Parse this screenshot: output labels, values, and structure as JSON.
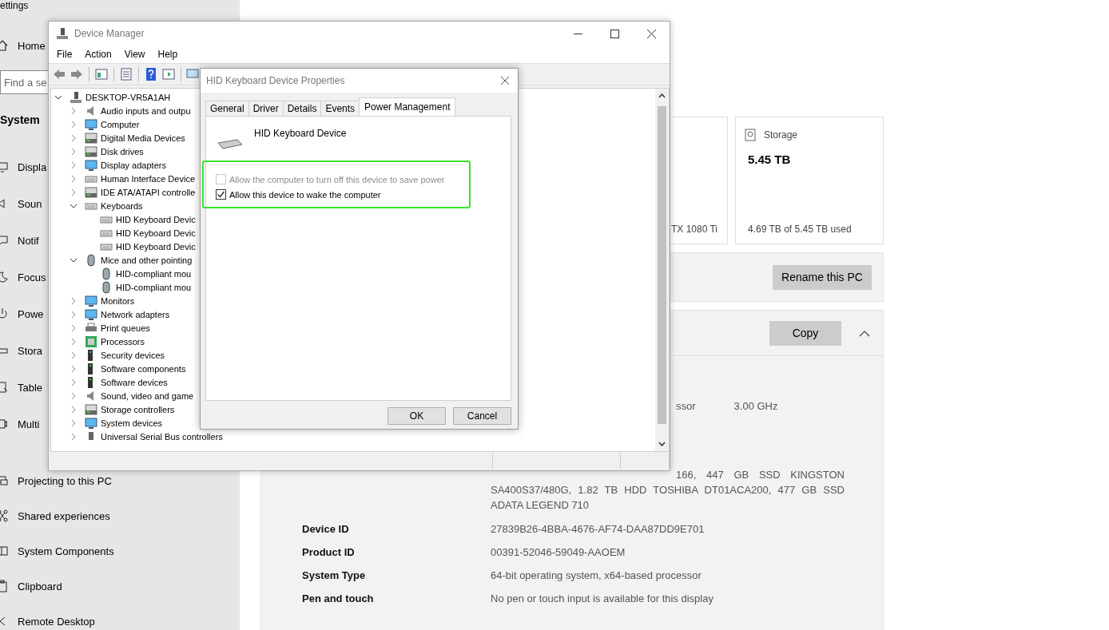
{
  "settings": {
    "title": "ettings",
    "home": "Home",
    "search": {
      "placeholder": "Find a se"
    },
    "section": "System",
    "nav": [
      {
        "label": "Displa"
      },
      {
        "label": "Soun"
      },
      {
        "label": "Notif"
      },
      {
        "label": "Focus"
      },
      {
        "label": "Powe"
      },
      {
        "label": "Stora"
      },
      {
        "label": "Table"
      },
      {
        "label": "Multi"
      },
      {
        "label": "Projecting to this PC"
      },
      {
        "label": "Shared experiences"
      },
      {
        "label": "System Components"
      },
      {
        "label": "Clipboard"
      },
      {
        "label": "Remote Desktop"
      }
    ],
    "gpu_card": {
      "detail": "TX 1080 Ti"
    },
    "storage_card": {
      "title": "Storage",
      "value": "5.45 TB",
      "detail": "4.69 TB of 5.45 TB used"
    },
    "rename_button": "Rename this PC",
    "specs": {
      "copy_button": "Copy",
      "expanded": true,
      "partial_rows": [
        {
          "fragments": [
            "ssor",
            "3.00 GHz"
          ]
        }
      ],
      "storage_value": {
        "first_line": "166,  447  GB  SSD  KINGSTON",
        "rest": "SA400S37/480G, 1.82 TB HDD TOSHIBA DT01ACA200, 477 GB SSD ADATA LEGEND 710"
      },
      "rows": [
        {
          "label": "Device ID",
          "value": "27839B26-4BBA-4676-AF74-DAA87DD9E701"
        },
        {
          "label": "Product ID",
          "value": "00391-52046-59049-AAOEM"
        },
        {
          "label": "System Type",
          "value": "64-bit operating system, x64-based processor"
        },
        {
          "label": "Pen and touch",
          "value": "No pen or touch input is available for this display"
        }
      ]
    }
  },
  "device_manager": {
    "title": "Device Manager",
    "menu": [
      "File",
      "Action",
      "View",
      "Help"
    ],
    "tree": {
      "label": "DESKTOP-VR5A1AH",
      "expanded": true,
      "children": [
        {
          "label": "Audio inputs and outpu",
          "expanded": false
        },
        {
          "label": "Computer",
          "expanded": false
        },
        {
          "label": "Digital Media Devices",
          "expanded": false
        },
        {
          "label": "Disk drives",
          "expanded": false
        },
        {
          "label": "Display adapters",
          "expanded": false
        },
        {
          "label": "Human Interface Device",
          "expanded": false
        },
        {
          "label": "IDE ATA/ATAPI controlle",
          "expanded": false
        },
        {
          "label": "Keyboards",
          "expanded": true,
          "children": [
            {
              "label": "HID Keyboard Devic"
            },
            {
              "label": "HID Keyboard Devic"
            },
            {
              "label": "HID Keyboard Devic"
            }
          ]
        },
        {
          "label": "Mice and other pointing",
          "expanded": true,
          "children": [
            {
              "label": "HID-compliant mou"
            },
            {
              "label": "HID-compliant mou"
            }
          ]
        },
        {
          "label": "Monitors",
          "expanded": false
        },
        {
          "label": "Network adapters",
          "expanded": false
        },
        {
          "label": "Print queues",
          "expanded": false
        },
        {
          "label": "Processors",
          "expanded": false
        },
        {
          "label": "Security devices",
          "expanded": false
        },
        {
          "label": "Software components",
          "expanded": false
        },
        {
          "label": "Software devices",
          "expanded": false
        },
        {
          "label": "Sound, video and game",
          "expanded": false
        },
        {
          "label": "Storage controllers",
          "expanded": false
        },
        {
          "label": "System devices",
          "expanded": false
        },
        {
          "label": "Universal Serial Bus controllers",
          "expanded": false
        }
      ]
    }
  },
  "dialog": {
    "title": "HID Keyboard Device Properties",
    "tabs": [
      {
        "label": "General",
        "selected": false
      },
      {
        "label": "Driver",
        "selected": false
      },
      {
        "label": "Details",
        "selected": false
      },
      {
        "label": "Events",
        "selected": false
      },
      {
        "label": "Power Management",
        "selected": true
      }
    ],
    "device_name": "HID Keyboard Device",
    "options": [
      {
        "label": "Allow the computer to turn off this device to save power",
        "checked": false,
        "disabled": true
      },
      {
        "label": "Allow this device to wake the computer",
        "checked": true,
        "disabled": false
      }
    ],
    "buttons": [
      "OK",
      "Cancel"
    ]
  }
}
